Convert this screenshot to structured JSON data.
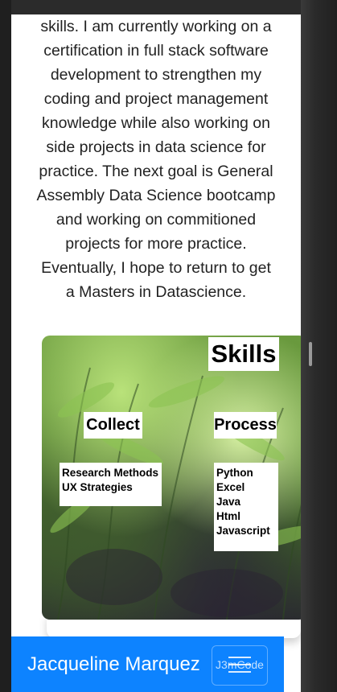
{
  "bio": {
    "lines": [
      "skills. I am currently working on a",
      "certification in full stack software",
      "development to strengthen my",
      "coding and project management",
      "knowledge while also working on",
      "side projects in data science for",
      "practice. The next goal is General",
      "Assembly Data Science bootcamp",
      "and working on commitioned",
      "projects for more practice.",
      "Eventually, I hope to return to get",
      "a Masters in Datascience."
    ]
  },
  "skills_image": {
    "title": "Skills",
    "collect_label": "Collect",
    "process_label": "Process",
    "collect_items": [
      "Research Methods",
      "UX Strategies"
    ],
    "process_items": [
      "Python",
      "Excel",
      "Java",
      "Html",
      "Javascript"
    ]
  },
  "footer": {
    "brand": "Jacqueline Marquez",
    "toggle_text": "J3mCode"
  },
  "colors": {
    "footer_bg": "#0d83ff",
    "page_bg": "#ffffff",
    "frame_bg": "#1f1f1f"
  }
}
